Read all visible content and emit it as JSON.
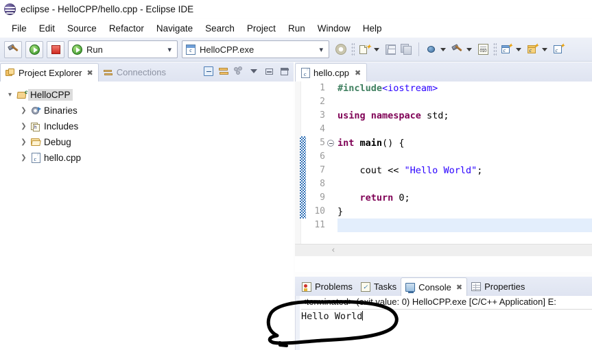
{
  "window": {
    "title": "eclipse - HelloCPP/hello.cpp - Eclipse IDE",
    "logo_icon": "eclipse-logo"
  },
  "menubar": {
    "items": [
      {
        "label": "File"
      },
      {
        "label": "Edit"
      },
      {
        "label": "Source"
      },
      {
        "label": "Refactor"
      },
      {
        "label": "Navigate"
      },
      {
        "label": "Search"
      },
      {
        "label": "Project"
      },
      {
        "label": "Run"
      },
      {
        "label": "Window"
      },
      {
        "label": "Help"
      }
    ]
  },
  "toolbar": {
    "build_icon": "hammer-icon",
    "run_icon": "run-icon",
    "stop_icon": "stop-icon",
    "run_combo": {
      "value": "Run",
      "icon": "run-icon"
    },
    "launch_combo": {
      "value": "HelloCPP.exe",
      "icon": "c-file-icon"
    },
    "gear_icon": "gear-icon",
    "right_icons": [
      {
        "name": "new-file-icon"
      },
      {
        "name": "save-icon"
      },
      {
        "name": "save-all-icon"
      },
      {
        "name": "debug-icon"
      },
      {
        "name": "build-hammer-icon"
      },
      {
        "name": "binary-icon"
      },
      {
        "name": "new-c-class-icon"
      },
      {
        "name": "new-cpp-class-icon"
      },
      {
        "name": "new-c-file-icon"
      }
    ]
  },
  "project_explorer": {
    "tabs": [
      {
        "label": "Project Explorer",
        "icon": "project-explorer-icon",
        "active": true,
        "closable": true
      },
      {
        "label": "Connections",
        "icon": "connections-icon",
        "active": false,
        "closable": false
      }
    ],
    "view_toolbar": [
      {
        "name": "collapse-all-icon"
      },
      {
        "name": "link-with-editor-icon"
      },
      {
        "name": "filter-icon"
      },
      {
        "name": "view-menu-icon"
      },
      {
        "name": "minimize-icon"
      },
      {
        "name": "maximize-icon"
      }
    ],
    "tree": [
      {
        "label": "HelloCPP",
        "icon": "project-icon",
        "twisty": "v",
        "selected": true,
        "indent": 0
      },
      {
        "label": "Binaries",
        "icon": "binaries-icon",
        "twisty": ">",
        "selected": false,
        "indent": 1
      },
      {
        "label": "Includes",
        "icon": "includes-icon",
        "twisty": ">",
        "selected": false,
        "indent": 1
      },
      {
        "label": "Debug",
        "icon": "folder-icon",
        "twisty": ">",
        "selected": false,
        "indent": 1
      },
      {
        "label": "hello.cpp",
        "icon": "source-file-icon",
        "twisty": ">",
        "selected": false,
        "indent": 1
      }
    ]
  },
  "editor": {
    "tab": {
      "label": "hello.cpp",
      "icon": "source-file-icon",
      "closable": true
    },
    "line_numbers": [
      "1",
      "2",
      "3",
      "4",
      "5",
      "6",
      "7",
      "8",
      "9",
      "10",
      "11"
    ],
    "current_line": 11,
    "fold_marker_line": 5,
    "annotation_bar": {
      "from_line": 5,
      "to_line": 10
    },
    "lines": [
      {
        "n": 1,
        "tokens": [
          {
            "t": "#include",
            "c": "k-pp"
          },
          {
            "t": "<iostream>",
            "c": "k-inc"
          }
        ]
      },
      {
        "n": 2,
        "tokens": []
      },
      {
        "n": 3,
        "tokens": [
          {
            "t": "using namespace",
            "c": "k-kw"
          },
          {
            "t": " std;",
            "c": "k-id"
          }
        ]
      },
      {
        "n": 4,
        "tokens": []
      },
      {
        "n": 5,
        "tokens": [
          {
            "t": "int",
            "c": "k-kw"
          },
          {
            "t": " ",
            "c": "k-id"
          },
          {
            "t": "main",
            "c": "k-fn"
          },
          {
            "t": "() {",
            "c": "k-id"
          }
        ]
      },
      {
        "n": 6,
        "tokens": []
      },
      {
        "n": 7,
        "tokens": [
          {
            "t": "    cout << ",
            "c": "k-id"
          },
          {
            "t": "\"Hello World\"",
            "c": "k-str"
          },
          {
            "t": ";",
            "c": "k-id"
          }
        ]
      },
      {
        "n": 8,
        "tokens": []
      },
      {
        "n": 9,
        "tokens": [
          {
            "t": "    ",
            "c": "k-id"
          },
          {
            "t": "return",
            "c": "k-kw"
          },
          {
            "t": " 0;",
            "c": "k-id"
          }
        ]
      },
      {
        "n": 10,
        "tokens": [
          {
            "t": "}",
            "c": "k-id"
          }
        ]
      },
      {
        "n": 11,
        "tokens": []
      }
    ],
    "hscroll_chevron": "‹"
  },
  "bottom_panel": {
    "tabs": [
      {
        "label": "Problems",
        "icon": "problems-icon",
        "active": false,
        "closable": false
      },
      {
        "label": "Tasks",
        "icon": "tasks-icon",
        "active": false,
        "closable": false
      },
      {
        "label": "Console",
        "icon": "console-icon",
        "active": true,
        "closable": true
      },
      {
        "label": "Properties",
        "icon": "properties-icon",
        "active": false,
        "closable": false
      }
    ],
    "console": {
      "header": "<terminated> (exit value: 0) HelloCPP.exe [C/C++ Application] E:",
      "output": "Hello World"
    }
  },
  "annotation": {
    "kind": "hand-drawn-ellipse-with-tail",
    "color": "#000000",
    "target": "Hello World"
  },
  "colors": {
    "chrome": "#e3e8f3",
    "tab_active": "#ffffff",
    "selection": "#dcdcdc",
    "current_line": "#e3eefc",
    "keyword": "#7f0055",
    "string": "#2a00ff",
    "preprocessor": "#3f7f5f",
    "annotation_bar": "#2e6fb6"
  }
}
